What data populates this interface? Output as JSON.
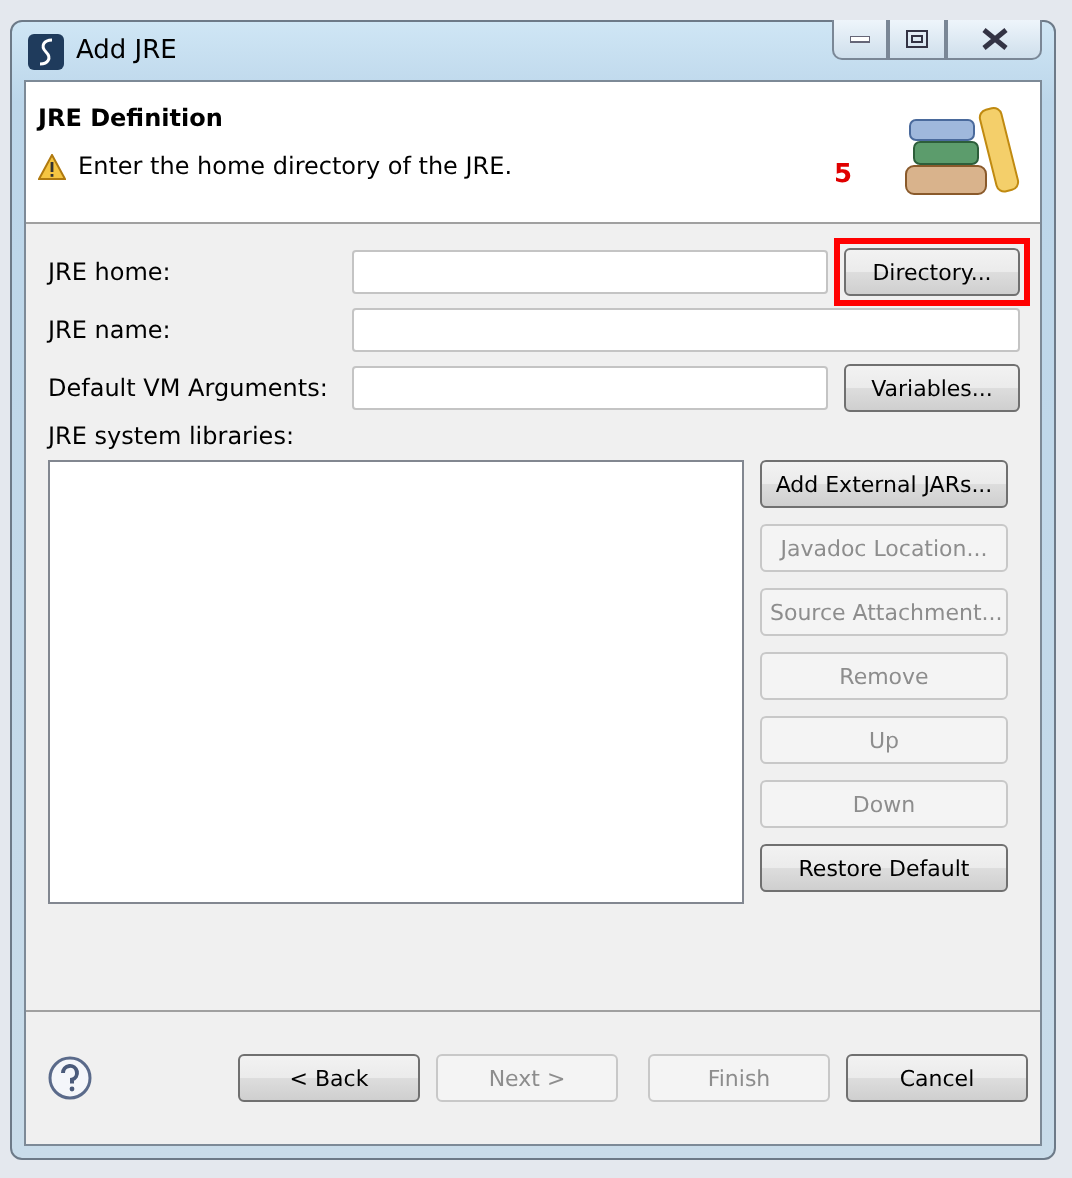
{
  "window": {
    "title": "Add JRE"
  },
  "header": {
    "title": "JRE Definition",
    "message": "Enter the home directory of the JRE.",
    "annotation": "5"
  },
  "fields": [
    {
      "label": "JRE home:",
      "button": {
        "label": "Directory...",
        "disabled": false,
        "highlighted": true
      }
    },
    {
      "label": "JRE name:"
    },
    {
      "label": "Default VM Arguments:",
      "button": {
        "label": "Variables...",
        "disabled": false
      }
    }
  ],
  "libraries": {
    "label": "JRE system libraries:",
    "buttons": [
      {
        "label": "Add External JARs...",
        "disabled": false
      },
      {
        "label": "Javadoc Location...",
        "disabled": true
      },
      {
        "label": "Source Attachment...",
        "disabled": true
      },
      {
        "label": "Remove",
        "disabled": true
      },
      {
        "label": "Up",
        "disabled": true
      },
      {
        "label": "Down",
        "disabled": true
      },
      {
        "label": "Restore Default",
        "disabled": false
      }
    ]
  },
  "footer": {
    "buttons": [
      {
        "label": "< Back",
        "disabled": false
      },
      {
        "label": "Next >",
        "disabled": true
      },
      {
        "label": "Finish",
        "disabled": true
      },
      {
        "label": "Cancel",
        "disabled": false
      }
    ]
  }
}
